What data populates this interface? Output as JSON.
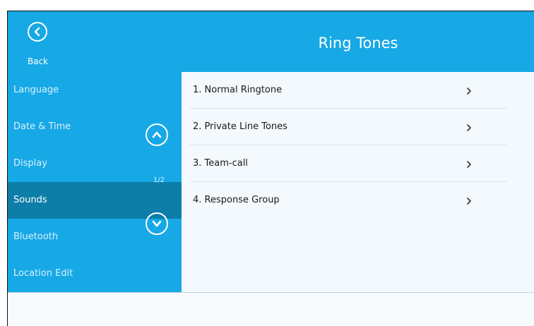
{
  "header": {
    "back_label": "Back",
    "title": "Ring Tones"
  },
  "sidebar": {
    "items": [
      {
        "label": "Language"
      },
      {
        "label": "Date & Time"
      },
      {
        "label": "Display"
      },
      {
        "label": "Sounds",
        "selected": true
      },
      {
        "label": "Bluetooth"
      },
      {
        "label": "Location Edit"
      }
    ],
    "page_indicator": "1/2"
  },
  "list": {
    "items": [
      {
        "label": "1. Normal Ringtone"
      },
      {
        "label": "2. Private Line Tones"
      },
      {
        "label": "3. Team-call"
      },
      {
        "label": "4. Response Group"
      }
    ]
  },
  "colors": {
    "accent": "#17a8e6",
    "selected": "#0c7ea7"
  },
  "icons": {
    "back": "chevron-left-circle-icon",
    "scroll_up": "chevron-up-circle-icon",
    "scroll_down": "chevron-down-circle-icon",
    "row": "chevron-right-icon"
  }
}
